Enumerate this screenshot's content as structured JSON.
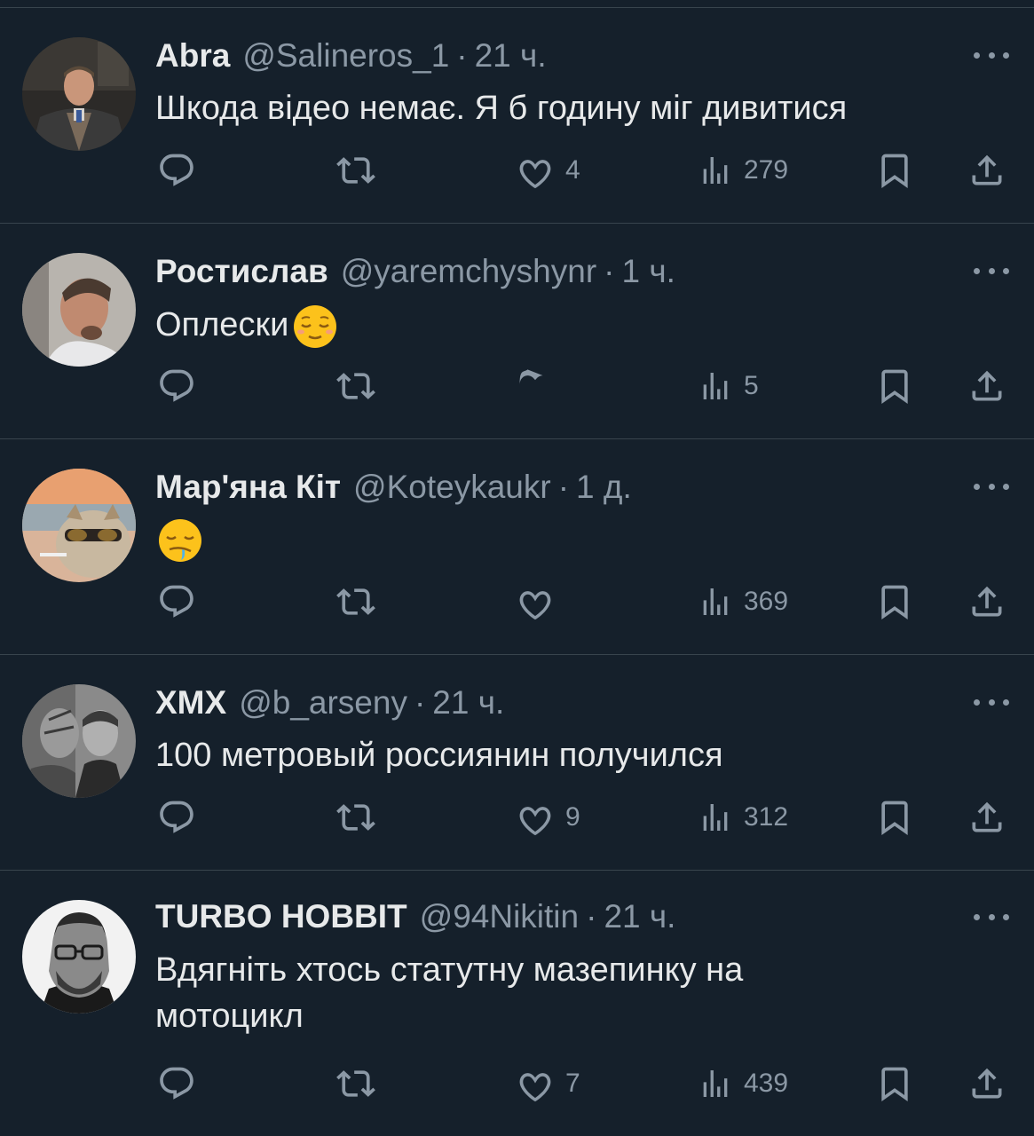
{
  "tweets": [
    {
      "name": "Abra",
      "handle": "@Salineros_1",
      "separator": "·",
      "time": "21 ч.",
      "text": "Шкода відео немає. Я б годину міг дивитися",
      "likes": "4",
      "views": "279"
    },
    {
      "name": "Ростислав",
      "handle": "@yaremchyshynr",
      "separator": "·",
      "time": "1 ч.",
      "text": "Оплески",
      "emoji": "relieved-face",
      "likes": "",
      "views": "5"
    },
    {
      "name": "Мар'яна Кіт",
      "handle": "@Koteykaukr",
      "separator": "·",
      "time": "1 д.",
      "text": "",
      "emoji": "drooling-face",
      "likes": "",
      "views": "369"
    },
    {
      "name": "ХМХ",
      "handle": "@b_arseny",
      "separator": "·",
      "time": "21 ч.",
      "text": "100 метровый россиянин получился",
      "likes": "9",
      "views": "312"
    },
    {
      "name": "TURBO HOBBIT",
      "handle": "@94Nikitin",
      "separator": "·",
      "time": "21 ч.",
      "text_line1": "Вдягніть хтось статутну мазепинку на",
      "text_line2": "мотоцикл",
      "likes": "7",
      "views": "439"
    }
  ],
  "icons": {
    "reply": "reply-icon",
    "retweet": "retweet-icon",
    "like": "heart-icon",
    "views": "views-icon",
    "bookmark": "bookmark-icon",
    "share": "share-icon",
    "more": "more-icon"
  },
  "colors": {
    "background": "#15202b",
    "divider": "#38444d",
    "primary_text": "#e7e9ea",
    "secondary_text": "#8b98a5"
  }
}
